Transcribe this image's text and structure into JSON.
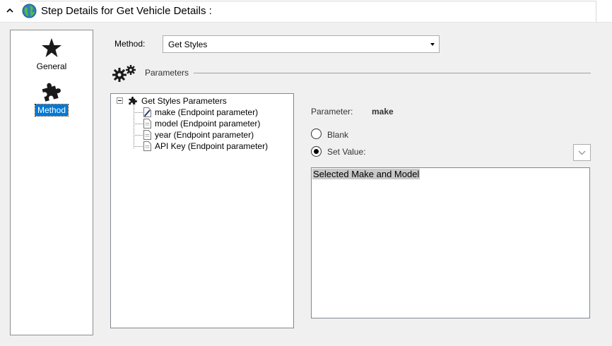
{
  "header": {
    "title": "Step Details for Get Vehicle Details :"
  },
  "sidebar": {
    "items": [
      {
        "label": "General",
        "icon": "star-icon",
        "selected": false
      },
      {
        "label": "Method",
        "icon": "puzzle-icon",
        "selected": true
      }
    ]
  },
  "method": {
    "label": "Method:",
    "selected_value": "Get Styles"
  },
  "parameters": {
    "section_label": "Parameters",
    "tree": {
      "root": "Get Styles Parameters",
      "children": [
        {
          "label": "make (Endpoint parameter)",
          "selected": true
        },
        {
          "label": "model (Endpoint parameter)",
          "selected": false
        },
        {
          "label": "year (Endpoint parameter)",
          "selected": false
        },
        {
          "label": "API Key (Endpoint parameter)",
          "selected": false
        }
      ]
    }
  },
  "detail": {
    "parameter_caption": "Parameter:",
    "parameter_name": "make",
    "blank_label": "Blank",
    "set_value_label": "Set Value:",
    "selected_option": "Set Value",
    "value_text": "Selected Make and Model"
  },
  "colors": {
    "selection": "#0078d7",
    "text_highlight": "#c8c8c8",
    "background": "#f0f0f0"
  }
}
